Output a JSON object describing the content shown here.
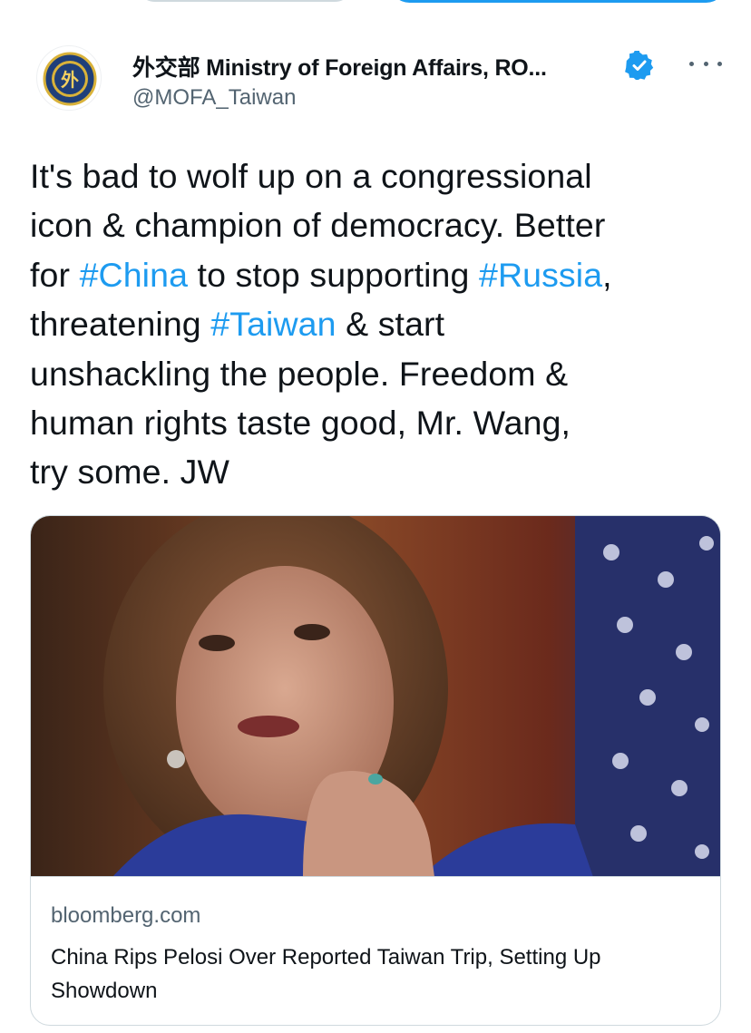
{
  "tweet": {
    "author": {
      "display_name": "外交部 Ministry of Foreign Affairs, RO...",
      "handle": "@MOFA_Taiwan",
      "verified": true,
      "avatar_icon": "mofa-seal-icon"
    },
    "text_lines": [
      [
        {
          "t": "It's bad to wolf up on a congressional"
        }
      ],
      [
        {
          "t": "icon & champion of democracy. Better"
        }
      ],
      [
        {
          "t": "for "
        },
        {
          "t": "#China",
          "tag": true
        },
        {
          "t": " to stop supporting "
        },
        {
          "t": "#Russia",
          "tag": true
        },
        {
          "t": ","
        }
      ],
      [
        {
          "t": "threatening "
        },
        {
          "t": "#Taiwan",
          "tag": true
        },
        {
          "t": " & start"
        }
      ],
      [
        {
          "t": "unshackling the people. Freedom &"
        }
      ],
      [
        {
          "t": "human rights taste good, Mr. Wang,"
        }
      ],
      [
        {
          "t": "try some. JW"
        }
      ]
    ],
    "link_card": {
      "domain": "bloomberg.com",
      "title": "China Rips Pelosi Over Reported Taiwan Trip, Setting Up Showdown"
    }
  },
  "colors": {
    "link_blue": "#1d9bf0",
    "text_primary": "#0f1419",
    "text_secondary": "#536471",
    "border": "#cfd9de"
  }
}
